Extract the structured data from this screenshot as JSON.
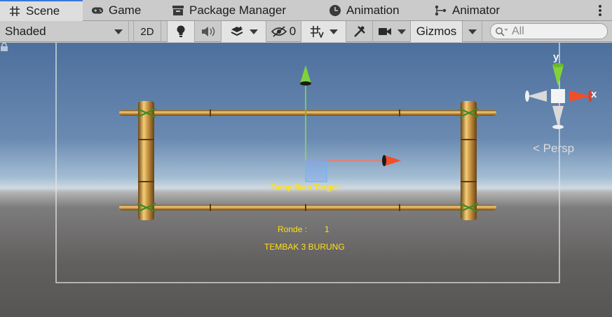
{
  "tabs": [
    {
      "label": "Scene",
      "icon": "grid-icon",
      "active": true
    },
    {
      "label": "Game",
      "icon": "gamepad-icon",
      "active": false
    },
    {
      "label": "Package Manager",
      "icon": "package-icon",
      "active": false
    },
    {
      "label": "Animation",
      "icon": "animation-clock-icon",
      "active": false
    },
    {
      "label": "Animator",
      "icon": "animator-icon",
      "active": false
    }
  ],
  "toolbar": {
    "shading_mode": "Shaded",
    "mode_2d": "2D",
    "hidden_count": "0",
    "gizmos": "Gizmos",
    "search_placeholder": "All"
  },
  "scene": {
    "ui_text_target": "Tampilkan Target",
    "ui_text_ronde_label": "Ronde :",
    "ui_text_ronde_value": "1",
    "ui_text_tembak": "TEMBAK 3 BURUNG",
    "projection": "< Persp",
    "gizmo_axis_y": "y",
    "gizmo_axis_x": "x"
  },
  "colors": {
    "ui_text": "#ffe018",
    "axis_y": "#8ee03a",
    "axis_x": "#f04f2a",
    "bamboo": "#c8913a"
  }
}
